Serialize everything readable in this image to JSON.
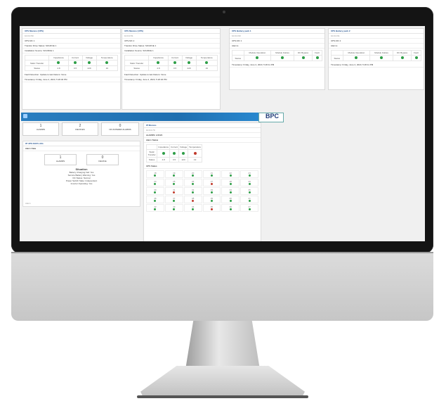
{
  "brand": {
    "logo_text": "BPC"
  },
  "top_cards": [
    {
      "title": "UPS Murano (UPS)",
      "ip": "10.0.0.50",
      "model": "UPS-MC 1",
      "transfer": "Transfer Drive Status: SOURCE 1",
      "source": "Installation Source: SOURCE 1",
      "headers": [
        "",
        "Impedance",
        "Current",
        "Voltage",
        "Temperature"
      ],
      "rows": [
        [
          "Static Transfer",
          "",
          "",
          "",
          ""
        ],
        [
          "Status",
          "4.8",
          "0.5",
          "220",
          "19"
        ]
      ],
      "fault": "Fault Detection: Update to last Data is: None",
      "timestamp": "Timestamp: Friday, June 2, 2023, 5:26:46 PM"
    },
    {
      "title": "UPS Murano (UPS)",
      "ip": "10.0.0.51",
      "model": "UPS-MC 2",
      "transfer": "Transfer Drive Status: SOURCE 1",
      "source": "Installation Source: SOURCE 1",
      "headers": [
        "",
        "Impedance",
        "Current",
        "Voltage",
        "Temperature"
      ],
      "rows": [
        [
          "Static Transfer",
          "",
          "",
          "",
          ""
        ],
        [
          "Status",
          "4.8",
          "0.5",
          "220",
          "19"
        ]
      ],
      "fault": "Fault Detection: Update to last Data is: None",
      "timestamp": "Timestamp: Friday, June 2, 2023, 5:26:46 PM"
    },
    {
      "title": "UPS Battery pack 1",
      "ip": "10.0.0.60",
      "model": "UPS-MC 1",
      "alarms": "Alarms",
      "headers": [
        "",
        "Module Operation",
        "Module Failure",
        "DC Bypass",
        "Fault"
      ],
      "status_label": "Status",
      "timestamp": "Timestamp: Friday, June 2, 2023, 5:26:11 PM"
    },
    {
      "title": "UPS Battery pack 2",
      "ip": "10.0.0.61",
      "model": "UPS-MC 2",
      "alarms": "Alarms",
      "headers": [
        "",
        "Module Operation",
        "Module Failure",
        "DC Bypass",
        "Fault"
      ],
      "status_label": "Status",
      "timestamp": "Timestamp: Friday, June 2, 2023, 5:26:11 PM"
    }
  ],
  "stats": [
    {
      "value": "1",
      "label": "ALARMS"
    },
    {
      "value": "2",
      "label": "DEVICES"
    },
    {
      "value": "0",
      "label": "NO ANSWER ALARMS"
    }
  ],
  "left_panel": {
    "title": "IP UPS DATA LOG",
    "subtitle": "Alarm Data",
    "box1": {
      "value": "1",
      "label": "ALARMS"
    },
    "box2": {
      "value": "0",
      "label": "DEVICE"
    },
    "detail_title": "Situation",
    "details": [
      "Battery Charging Fail: Yes",
      "Service Battery Warning: Yes",
      "DC Status: Normal",
      "Power Switch State: Independent",
      "Inverter Operating: Yes"
    ],
    "footer": "Alarm"
  },
  "grid_card": {
    "title": "IP Murano",
    "ip": "10.0.0.70",
    "model": "ALARMS: 1/2/3/4",
    "section": "Alarm Status",
    "headers": [
      "",
      "Impedance",
      "Current",
      "Voltage",
      "Temperature"
    ],
    "row1_label": "Static Transfer",
    "row2": [
      "Status",
      "4.8",
      "0.5",
      "220",
      "19"
    ],
    "grid_title": "UPS Status",
    "cells": [
      "18",
      "19",
      "20",
      "21",
      "22",
      "23",
      "24",
      "25",
      "26",
      "27",
      "28",
      "29",
      "30",
      "31",
      "32",
      "33",
      "34",
      "35",
      "36",
      "37",
      "38",
      "39",
      "40",
      "41",
      "42",
      "43",
      "44",
      "45",
      "46",
      "47"
    ],
    "red_cells": [
      9,
      13,
      20,
      27
    ]
  },
  "colors": {
    "accent": "#1f6fb0",
    "ok": "#2e9e47",
    "alarm": "#c0392b"
  }
}
